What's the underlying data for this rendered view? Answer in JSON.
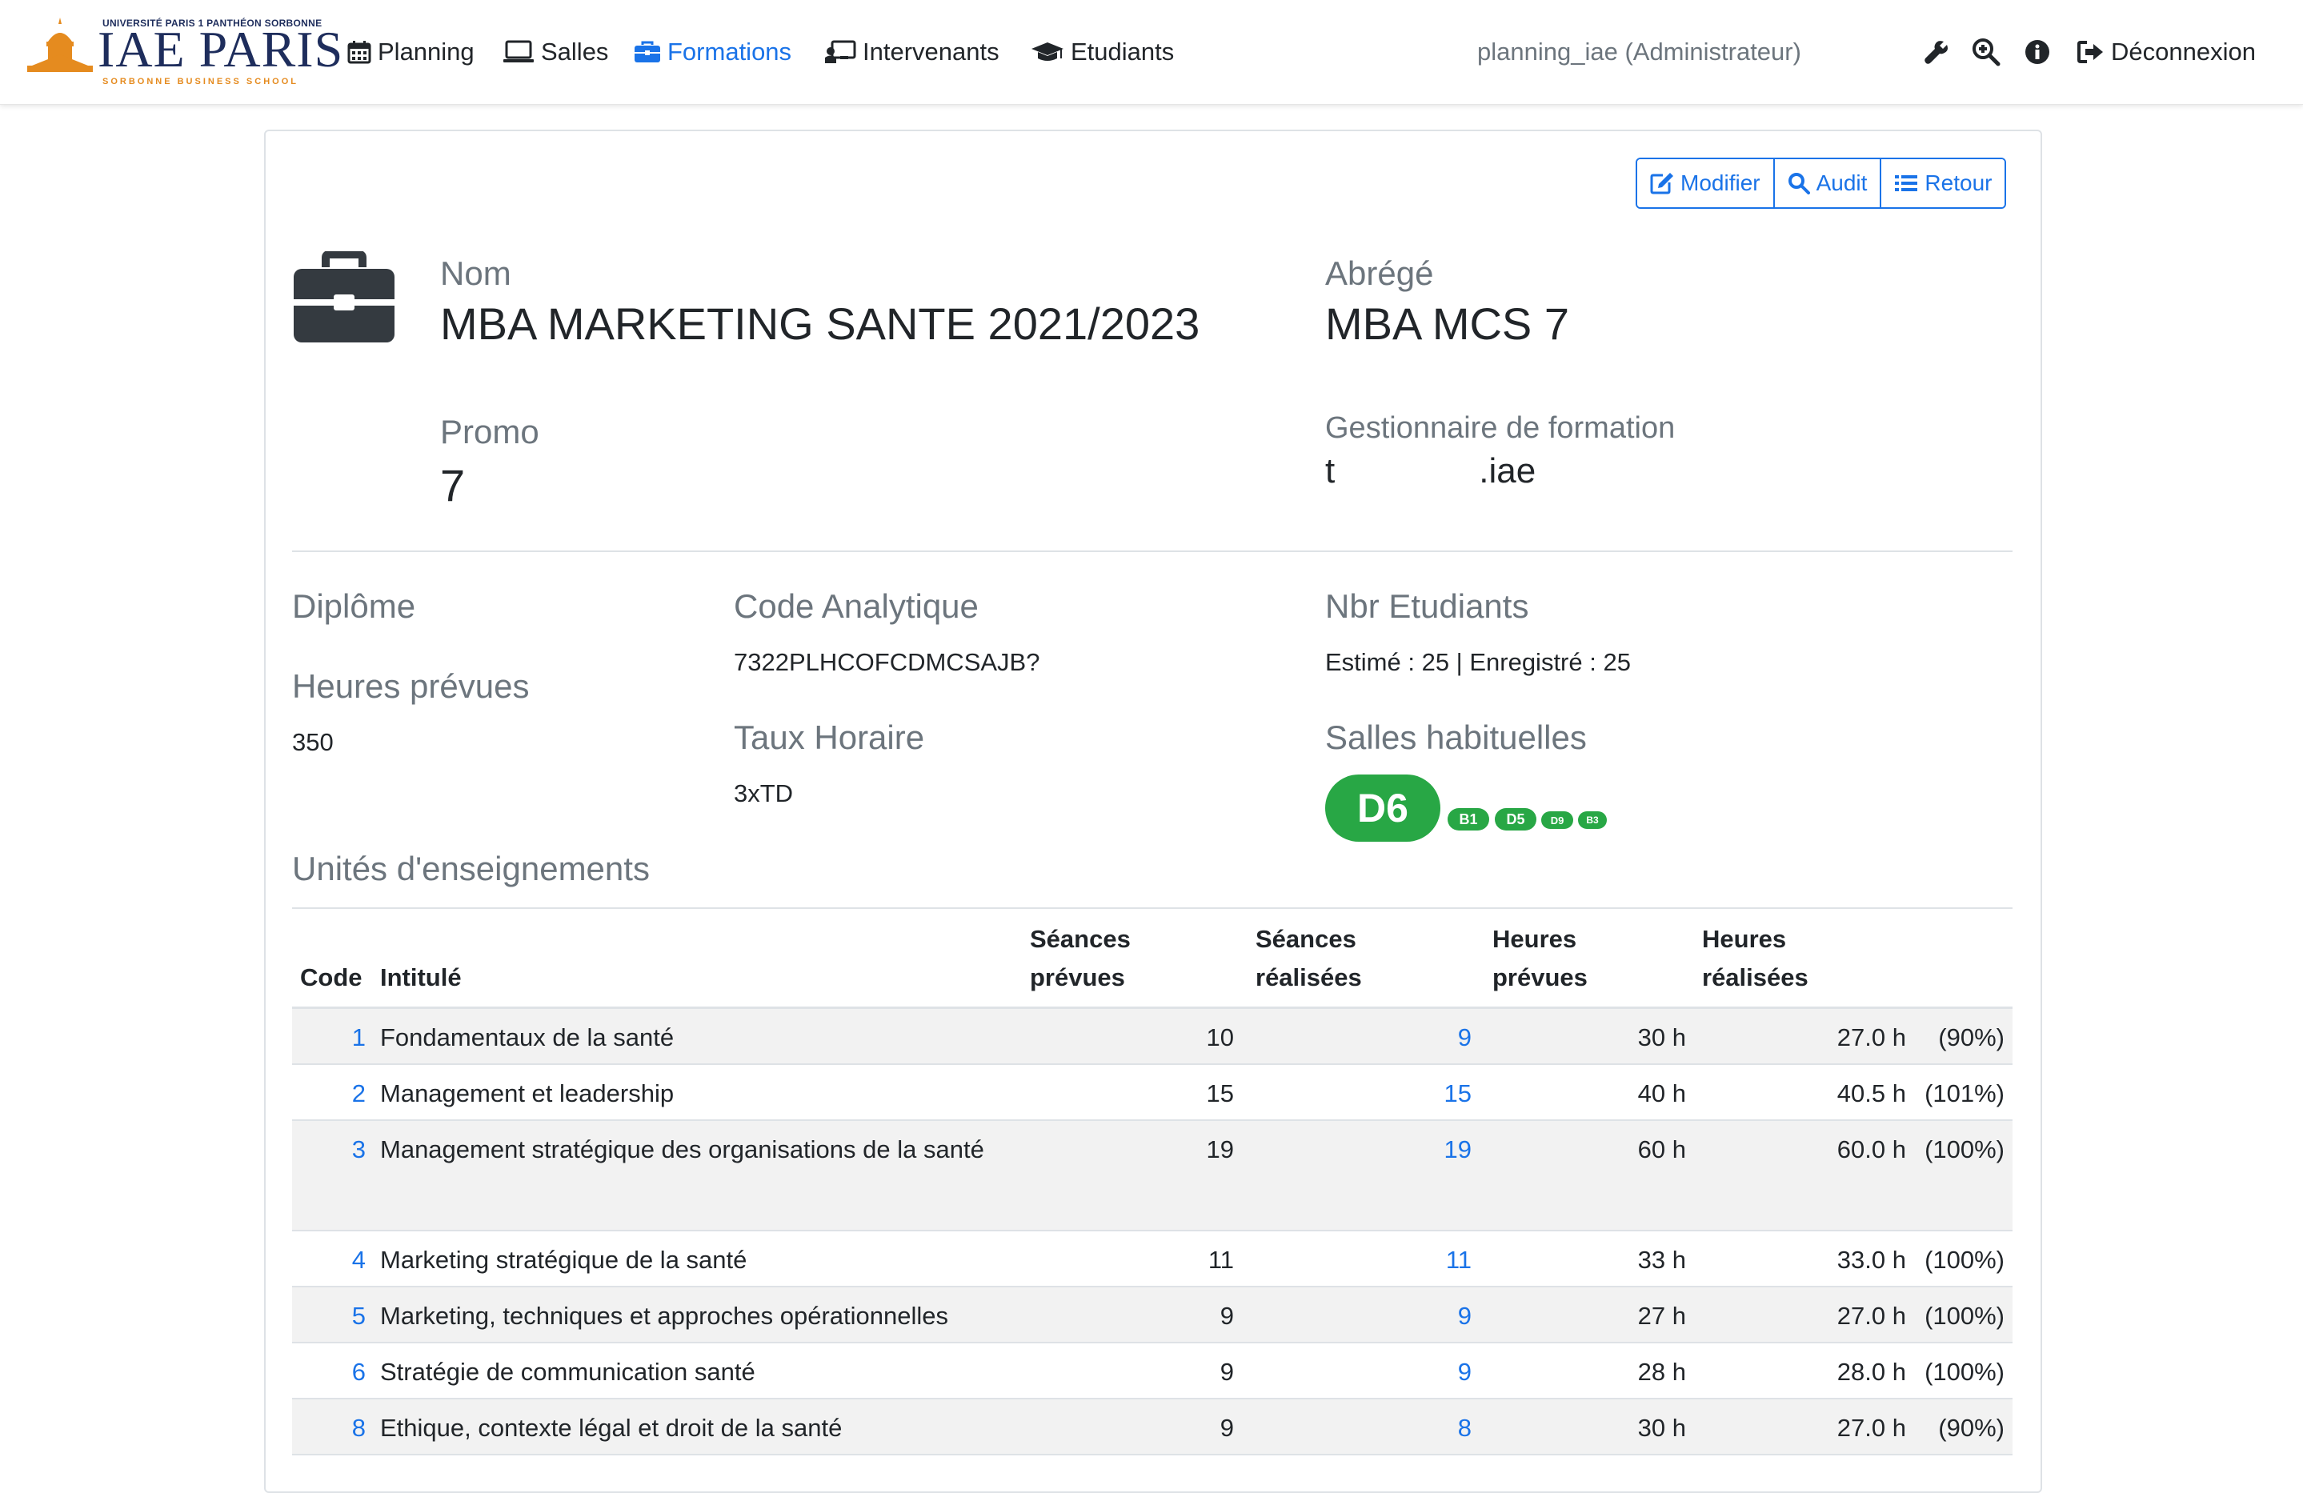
{
  "navbar": {
    "logo": {
      "top_line": "UNIVERSITÉ PARIS 1 PANTHÉON SORBONNE",
      "main": "IAE PARIS",
      "sub": "SORBONNE BUSINESS SCHOOL"
    },
    "items": [
      {
        "label": "Planning",
        "icon": "calendar-icon",
        "active": false
      },
      {
        "label": "Salles",
        "icon": "laptop-icon",
        "active": false
      },
      {
        "label": "Formations",
        "icon": "briefcase-icon",
        "active": true
      },
      {
        "label": "Intervenants",
        "icon": "chalkboard-teacher-icon",
        "active": false
      },
      {
        "label": "Etudiants",
        "icon": "graduation-cap-icon",
        "active": false
      }
    ],
    "user": "planning_iae (Administrateur)",
    "logout": "Déconnexion",
    "accent": "#1a73e8"
  },
  "actions": {
    "modifier": "Modifier",
    "audit": "Audit",
    "retour": "Retour"
  },
  "formation": {
    "nom_label": "Nom",
    "nom": "MBA MARKETING SANTE 2021/2023",
    "abrege_label": "Abrégé",
    "abrege": "MBA MCS 7",
    "promo_label": "Promo",
    "promo": "7",
    "gestionnaire_label": "Gestionnaire de formation",
    "gestionnaire_prefix": "t",
    "gestionnaire_suffix": ".iae",
    "diplome_label": "Diplôme",
    "heures_label": "Heures prévues",
    "heures": "350",
    "code_label": "Code Analytique",
    "code": "7322PLHCOFCDMCSAJB?",
    "taux_label": "Taux Horaire",
    "taux": "3xTD",
    "nbr_label": "Nbr Etudiants",
    "nbr": "Estimé : 25 | Enregistré : 25",
    "salles_label": "Salles habituelles",
    "salles": [
      "D6",
      "B1",
      "D5",
      "D9",
      "B3"
    ],
    "salles_color": "#28a745"
  },
  "ue": {
    "title": "Unités d'enseignements",
    "headers": {
      "code": "Code",
      "intitule": "Intitulé",
      "seances_prevues_1": "Séances",
      "seances_prevues_2": "prévues",
      "seances_realisees_1": "Séances",
      "seances_realisees_2": "réalisées",
      "heures_prevues_1": "Heures",
      "heures_prevues_2": "prévues",
      "heures_realisees_1": "Heures",
      "heures_realisees_2": "réalisées"
    },
    "rows": [
      {
        "code": "1",
        "intitule": "Fondamentaux de la santé",
        "sp": "10",
        "sr": "9",
        "hp": "30 h",
        "hr": "27.0 h",
        "pct": "(90%)"
      },
      {
        "code": "2",
        "intitule": "Management et leadership",
        "sp": "15",
        "sr": "15",
        "hp": "40 h",
        "hr": "40.5 h",
        "pct": "(101%)"
      },
      {
        "code": "3",
        "intitule": "Management stratégique des organisations de la santé",
        "sp": "19",
        "sr": "19",
        "hp": "60 h",
        "hr": "60.0 h",
        "pct": "(100%)"
      },
      {
        "code": "4",
        "intitule": "Marketing stratégique de la santé",
        "sp": "11",
        "sr": "11",
        "hp": "33 h",
        "hr": "33.0 h",
        "pct": "(100%)"
      },
      {
        "code": "5",
        "intitule": "Marketing, techniques et approches opérationnelles",
        "sp": "9",
        "sr": "9",
        "hp": "27 h",
        "hr": "27.0 h",
        "pct": "(100%)"
      },
      {
        "code": "6",
        "intitule": "Stratégie de communication santé",
        "sp": "9",
        "sr": "9",
        "hp": "28 h",
        "hr": "28.0 h",
        "pct": "(100%)"
      },
      {
        "code": "8",
        "intitule": "Ethique, contexte légal et droit de la santé",
        "sp": "9",
        "sr": "8",
        "hp": "30 h",
        "hr": "27.0 h",
        "pct": "(90%)"
      }
    ]
  }
}
